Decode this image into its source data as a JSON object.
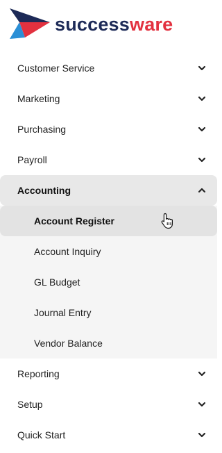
{
  "brand": {
    "name_part1": "success",
    "name_part2": "ware",
    "colors": {
      "navy": "#1d2a57",
      "red": "#e2313f",
      "blue": "#2b8fd6"
    }
  },
  "menu": {
    "items": [
      {
        "label": "Customer Service",
        "icon": "chevron-down-icon"
      },
      {
        "label": "Marketing",
        "icon": "chevron-down-icon"
      },
      {
        "label": "Purchasing",
        "icon": "chevron-down-icon"
      },
      {
        "label": "Payroll",
        "icon": "chevron-down-icon"
      },
      {
        "label": "Accounting",
        "icon": "chevron-up-icon",
        "expanded": true
      },
      {
        "label": "Reporting",
        "icon": "chevron-down-icon"
      },
      {
        "label": "Setup",
        "icon": "chevron-down-icon"
      },
      {
        "label": "Quick Start",
        "icon": "chevron-down-icon"
      }
    ],
    "accounting_sub": [
      {
        "label": "Account Register",
        "active": true
      },
      {
        "label": "Account Inquiry"
      },
      {
        "label": "GL Budget"
      },
      {
        "label": "Journal Entry"
      },
      {
        "label": "Vendor Balance"
      }
    ]
  },
  "cursor": {
    "icon": "hand-pointer-icon"
  }
}
